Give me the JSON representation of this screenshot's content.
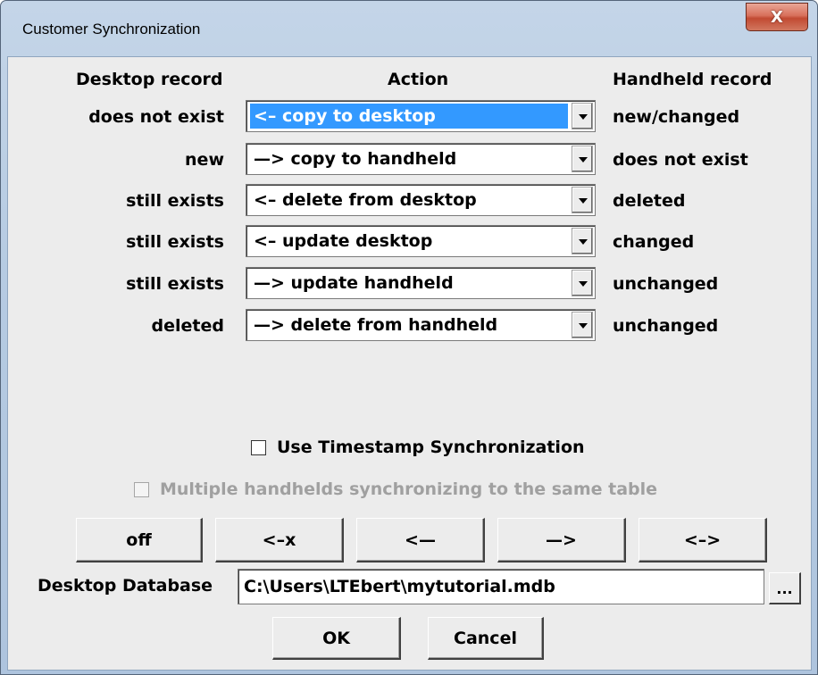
{
  "window": {
    "title": "Customer Synchronization",
    "close_glyph": "X"
  },
  "headers": {
    "desktop": "Desktop record",
    "action": "Action",
    "handheld": "Handheld record"
  },
  "rows": [
    {
      "desktop": "does not exist",
      "action": "<– copy to desktop",
      "handheld": "new/changed",
      "selected": true
    },
    {
      "desktop": "new",
      "action": "—> copy to handheld",
      "handheld": "does not exist"
    },
    {
      "desktop": "still exists",
      "action": "<– delete from desktop",
      "handheld": "deleted"
    },
    {
      "desktop": "still exists",
      "action": "<– update desktop",
      "handheld": "changed"
    },
    {
      "desktop": "still exists",
      "action": "—> update handheld",
      "handheld": "unchanged"
    },
    {
      "desktop": "deleted",
      "action": "—> delete from handheld",
      "handheld": "unchanged"
    }
  ],
  "options": {
    "timestamp_label": "Use Timestamp Synchronization",
    "timestamp_checked": false,
    "multiple_label": "Multiple handhelds synchronizing to the same table",
    "multiple_checked": false,
    "multiple_enabled": false
  },
  "direction_buttons": [
    "off",
    "<–x",
    "<—",
    "—>",
    "<–>"
  ],
  "database": {
    "label": "Desktop Database",
    "value": "C:\\Users\\LTEbert\\mytutorial.mdb",
    "browse_label": "..."
  },
  "dialog_buttons": {
    "ok": "OK",
    "cancel": "Cancel"
  },
  "colors": {
    "selection": "#3399ff",
    "close_button": "#c94f38",
    "disabled_text": "#a0a0a0"
  }
}
